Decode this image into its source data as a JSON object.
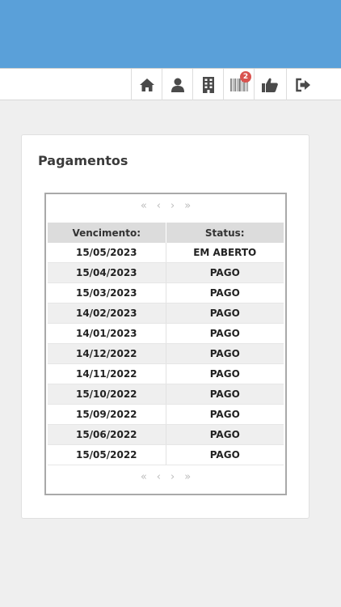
{
  "header": {
    "brand_color": "#5aa0d9",
    "icons": [
      {
        "name": "home-icon"
      },
      {
        "name": "user-icon"
      },
      {
        "name": "building-icon"
      },
      {
        "name": "barcode-icon",
        "badge": "2"
      },
      {
        "name": "thumbs-up-icon"
      },
      {
        "name": "logout-icon"
      }
    ]
  },
  "card": {
    "title": "Pagamentos"
  },
  "table": {
    "pager": {
      "first": "«",
      "prev": "‹",
      "next": "›",
      "last": "»"
    },
    "columns": [
      "Vencimento:",
      "Status:"
    ],
    "rows": [
      {
        "due": "15/05/2023",
        "status": "EM ABERTO"
      },
      {
        "due": "15/04/2023",
        "status": "PAGO"
      },
      {
        "due": "15/03/2023",
        "status": "PAGO"
      },
      {
        "due": "14/02/2023",
        "status": "PAGO"
      },
      {
        "due": "14/01/2023",
        "status": "PAGO"
      },
      {
        "due": "14/12/2022",
        "status": "PAGO"
      },
      {
        "due": "14/11/2022",
        "status": "PAGO"
      },
      {
        "due": "15/10/2022",
        "status": "PAGO"
      },
      {
        "due": "15/09/2022",
        "status": "PAGO"
      },
      {
        "due": "15/06/2022",
        "status": "PAGO"
      },
      {
        "due": "15/05/2022",
        "status": "PAGO"
      }
    ]
  }
}
